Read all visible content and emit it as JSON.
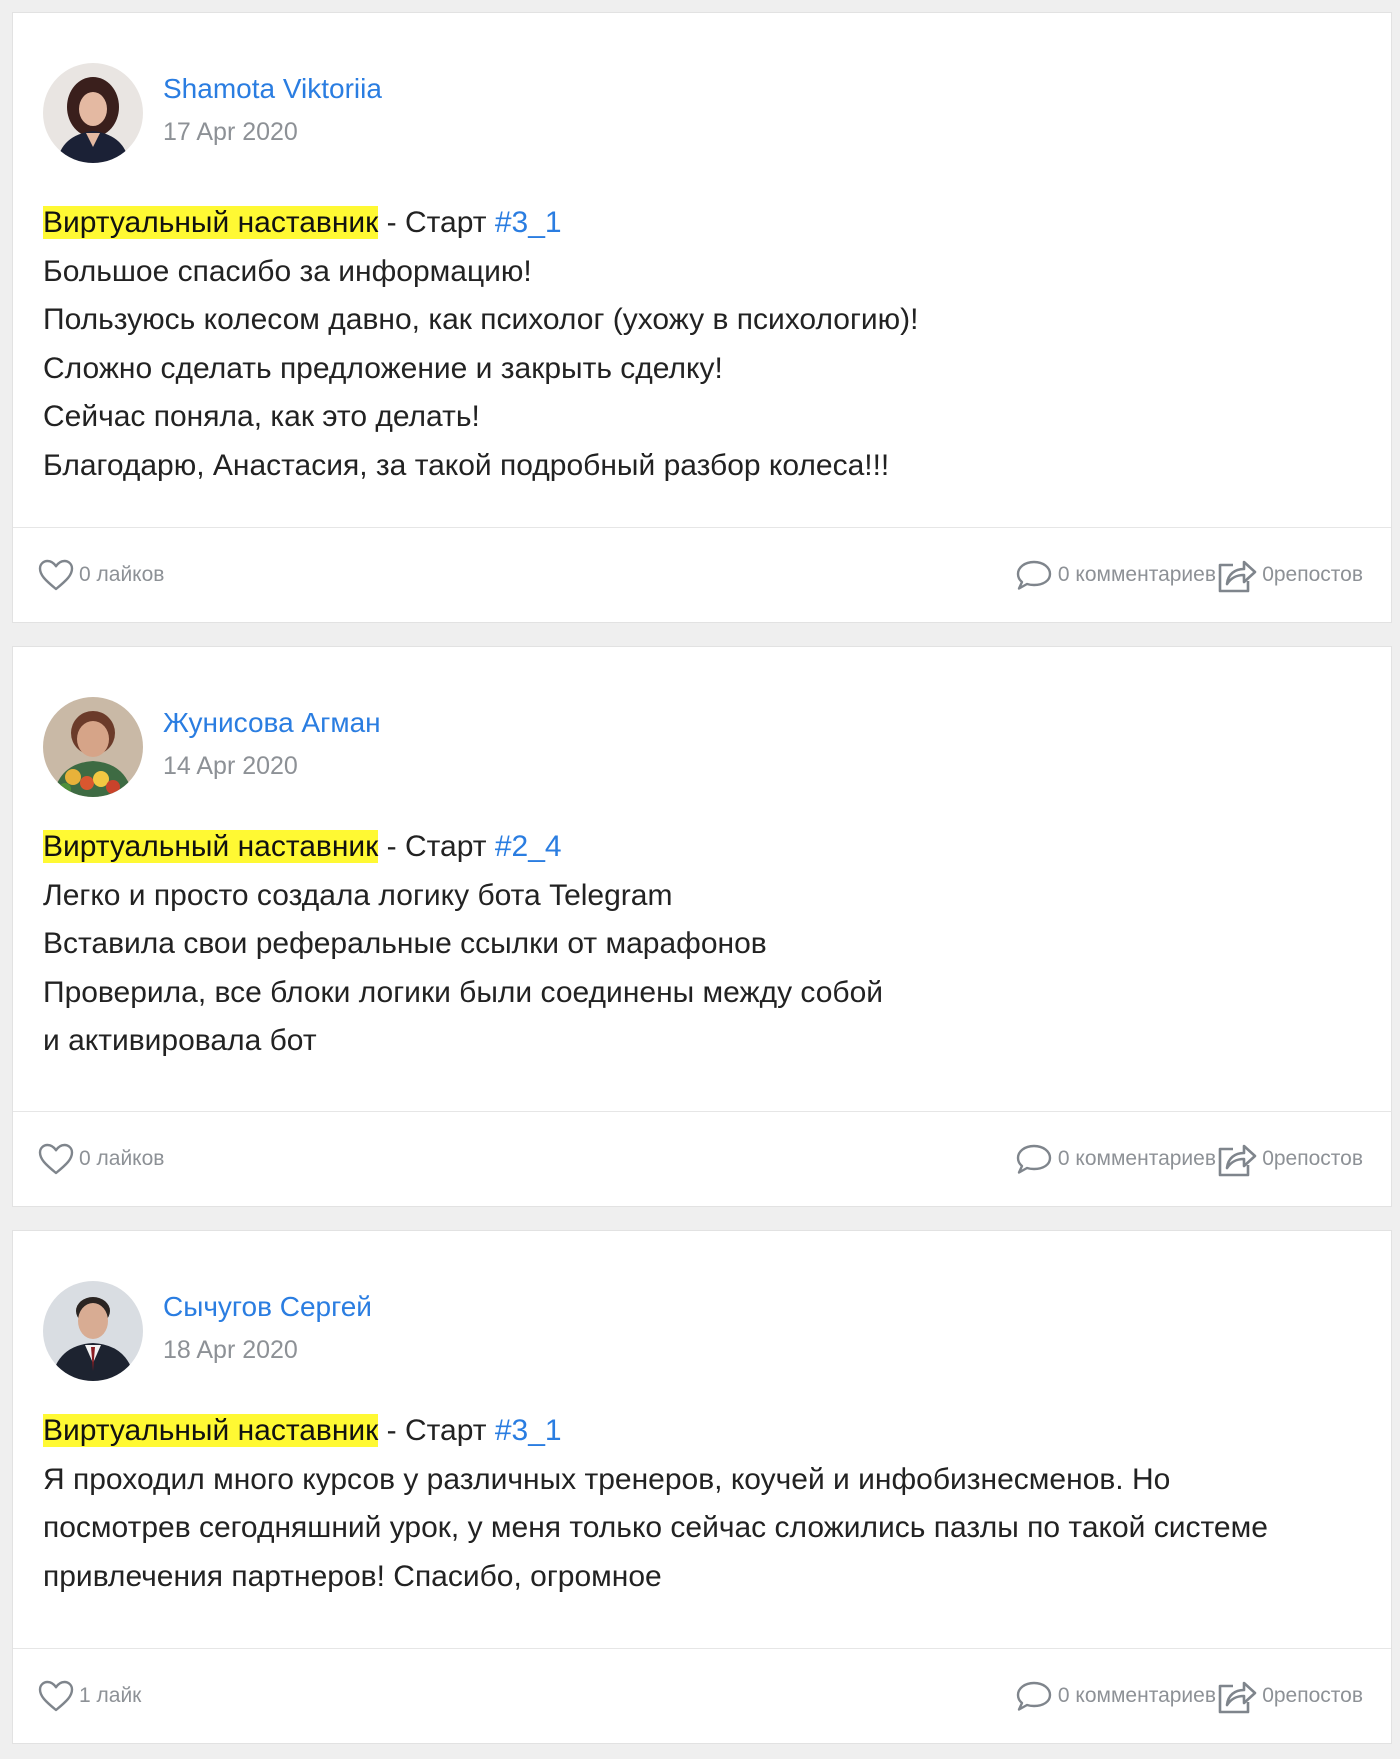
{
  "posts": [
    {
      "author": "Shamota Viktoriia",
      "date": "17 Apr 2020",
      "tag_highlight": "Виртуальный наставник",
      "tag_separator": " - Старт ",
      "hashtag": "#3_1",
      "lines": [
        "Большое спасибо за информацию!",
        "Пользуюсь колесом давно, как психолог (ухожу в психологию)!",
        "Сложно сделать предложение и закрыть сделку!",
        "Сейчас поняла, как это делать!",
        "Благодарю, Анастасия, за такой подробный разбор колеса!!!"
      ],
      "likes": "0 лайков",
      "comments": "0 комментариев",
      "reposts": "0репостов"
    },
    {
      "author": "Жунисова Агман",
      "date": "14 Apr 2020",
      "tag_highlight": "Виртуальный наставник",
      "tag_separator": " - Старт ",
      "hashtag": "#2_4",
      "lines": [
        "Легко и просто создала логику бота Telegram",
        "Вставила свои реферальные ссылки от марафонов",
        "Проверила, все блоки логики были соединены между собой",
        "и активировала  бот"
      ],
      "likes": "0 лайков",
      "comments": "0 комментариев",
      "reposts": "0репостов"
    },
    {
      "author": "Сычугов Сергей",
      "date": "18 Apr 2020",
      "tag_highlight": "Виртуальный наставник",
      "tag_separator": " - Старт ",
      "hashtag": "#3_1",
      "lines": [
        "Я проходил много курсов у различных тренеров, коучей и инфобизнесменов. Но",
        "посмотрев сегодняшний урок, у меня только сейчас сложились пазлы по такой системе",
        "привлечения партнеров! Спасибо, огромное"
      ],
      "likes": "1 лайк",
      "comments": "0 комментариев",
      "reposts": "0репостов"
    }
  ],
  "colors": {
    "link": "#2a7de1",
    "highlight": "#fff933",
    "muted": "#8d9196",
    "background": "#efefef"
  },
  "icons": [
    "heart-icon",
    "comment-bubble-icon",
    "share-arrow-icon"
  ]
}
